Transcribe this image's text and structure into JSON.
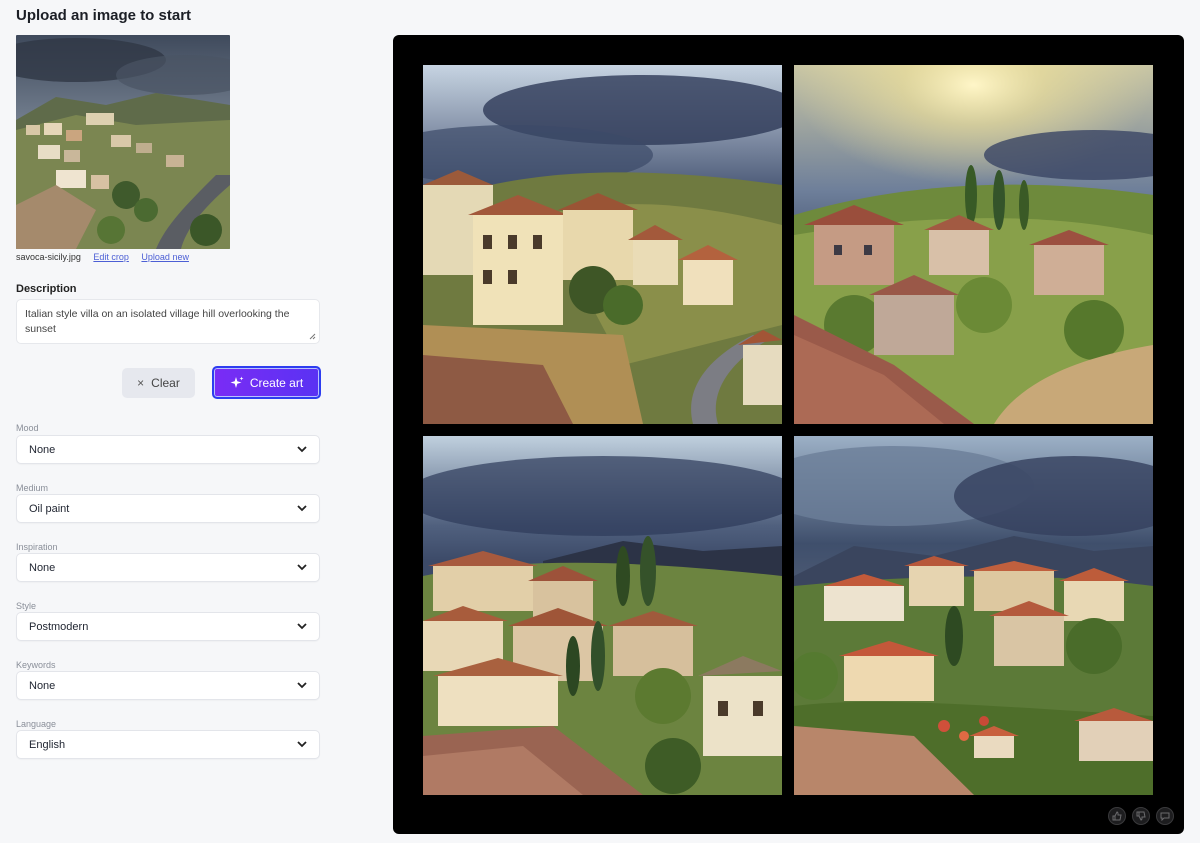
{
  "page": {
    "title": "Upload an image to start"
  },
  "upload": {
    "filename": "savoca-sicily.jpg",
    "edit_crop": "Edit crop",
    "upload_new": "Upload new"
  },
  "description": {
    "label": "Description",
    "value": "Italian style villa on an isolated village hill overlooking the sunset"
  },
  "actions": {
    "clear_label": "Clear",
    "create_label": "Create art"
  },
  "fields": [
    {
      "label": "Mood",
      "value": "None"
    },
    {
      "label": "Medium",
      "value": "Oil paint"
    },
    {
      "label": "Inspiration",
      "value": "None"
    },
    {
      "label": "Style",
      "value": "Postmodern"
    },
    {
      "label": "Keywords",
      "value": "None"
    },
    {
      "label": "Language",
      "value": "English"
    }
  ],
  "gallery": {
    "tiles": [
      "generated-image-1",
      "generated-image-2",
      "generated-image-3",
      "generated-image-4"
    ],
    "icons": [
      "like-icon",
      "dislike-icon",
      "comment-icon"
    ]
  },
  "colors": {
    "accent_gradient_start": "#7a2cf5",
    "accent_gradient_end": "#5a32f3",
    "accent_border": "#2d3df0",
    "link": "#4c5fd5"
  }
}
